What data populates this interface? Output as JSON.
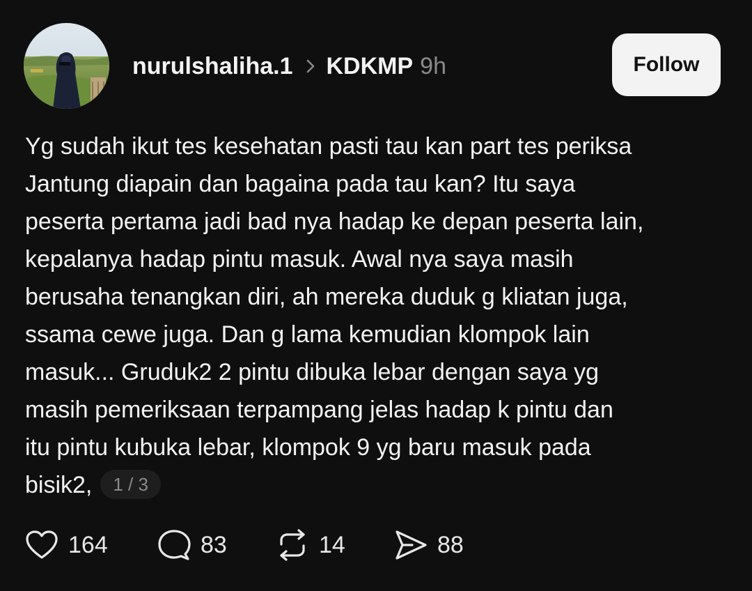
{
  "post": {
    "author": {
      "username": "nurulshaliha.1"
    },
    "community": "KDKMP",
    "timestamp": "9h",
    "follow_label": "Follow",
    "text_lines": [
      "Yg sudah ikut tes kesehatan pasti tau kan part tes periksa",
      "Jantung diapain dan bagaina pada tau kan? Itu saya",
      "peserta pertama jadi bad nya hadap ke depan peserta lain,",
      "kepalanya hadap pintu masuk. Awal nya saya masih",
      "berusaha tenangkan diri, ah mereka duduk g kliatan juga,",
      "ssama cewe juga. Dan g lama kemudian klompok lain",
      "masuk... Gruduk2 2 pintu dibuka lebar dengan saya yg",
      "masih pemeriksaan terpampang jelas hadap k pintu dan",
      "itu pintu kubuka lebar, klompok 9 yg baru masuk pada",
      "bisik2,"
    ],
    "page_indicator": "1 / 3",
    "stats": {
      "likes": "164",
      "replies": "83",
      "reposts": "14",
      "shares": "88"
    },
    "icons": {
      "like": "heart-icon",
      "reply": "speech-bubble-icon",
      "repost": "repost-arrows-icon",
      "share": "paper-plane-icon"
    },
    "colors": {
      "background": "#0f0f0f",
      "text": "#f3f3f3",
      "muted": "#8a8a8a",
      "follow_bg": "#f3f3f3"
    }
  }
}
